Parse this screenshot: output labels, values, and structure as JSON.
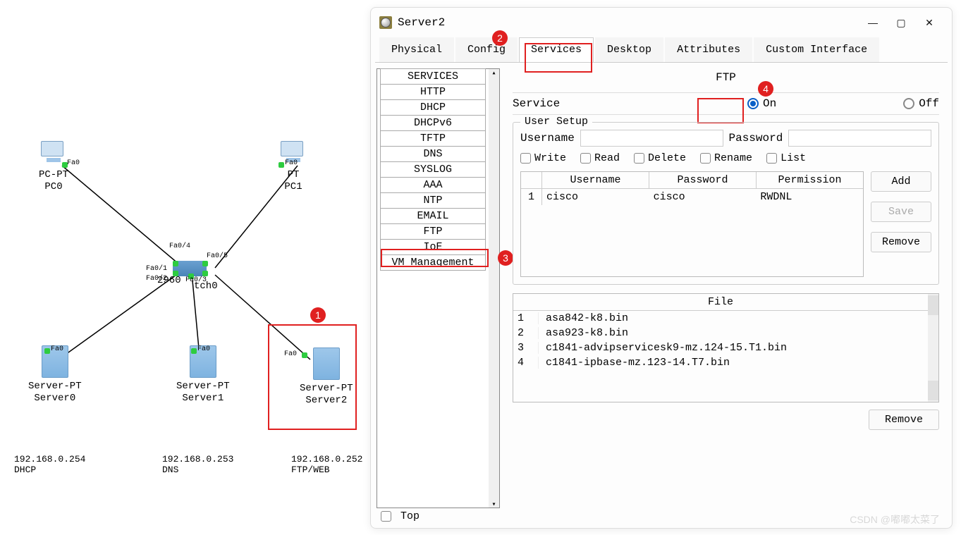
{
  "topology": {
    "pc0": {
      "label1": "PC-PT",
      "label2": "PC0",
      "port": "Fa0"
    },
    "pc1": {
      "label1": "PT",
      "label2": "PC1",
      "port": "Fa0"
    },
    "switch": {
      "label": "tch0",
      "hub": "2960",
      "ports": {
        "p1": "Fa0/1",
        "p2": "Fa0/2",
        "p3": "Fa0/3",
        "p4": "Fa0/4",
        "p5": "Fa0/5"
      }
    },
    "server0": {
      "label1": "Server-PT",
      "label2": "Server0",
      "port": "Fa0",
      "ip": "192.168.0.254",
      "svc": "DHCP"
    },
    "server1": {
      "label1": "Server-PT",
      "label2": "Server1",
      "port": "Fa0",
      "ip": "192.168.0.253",
      "svc": "DNS"
    },
    "server2": {
      "label1": "Server-PT",
      "label2": "Server2",
      "port": "Fa0",
      "ip": "192.168.0.252",
      "svc": "FTP/WEB"
    }
  },
  "badges": {
    "b1": "1",
    "b2": "2",
    "b3": "3",
    "b4": "4"
  },
  "dialog": {
    "title": "Server2",
    "tabs": {
      "physical": "Physical",
      "config": "Config",
      "services": "Services",
      "desktop": "Desktop",
      "attributes": "Attributes",
      "custom": "Custom Interface"
    },
    "services": [
      "SERVICES",
      "HTTP",
      "DHCP",
      "DHCPv6",
      "TFTP",
      "DNS",
      "SYSLOG",
      "AAA",
      "NTP",
      "EMAIL",
      "FTP",
      "IoE",
      "VM Management"
    ],
    "ftp": {
      "title": "FTP",
      "serviceLabel": "Service",
      "onLabel": "On",
      "offLabel": "Off",
      "userSetup": "User Setup",
      "usernameLabel": "Username",
      "passwordLabel": "Password",
      "perms": {
        "write": "Write",
        "read": "Read",
        "delete": "Delete",
        "rename": "Rename",
        "list": "List"
      },
      "tableHeaders": {
        "idx": "",
        "user": "Username",
        "pass": "Password",
        "perm": "Permission"
      },
      "users": [
        {
          "idx": "1",
          "name": "cisco",
          "pass": "cisco",
          "perm": "RWDNL"
        }
      ],
      "buttons": {
        "add": "Add",
        "save": "Save",
        "remove": "Remove"
      },
      "fileHeader": "File",
      "files": [
        {
          "idx": "1",
          "name": "asa842-k8.bin"
        },
        {
          "idx": "2",
          "name": "asa923-k8.bin"
        },
        {
          "idx": "3",
          "name": "c1841-advipservicesk9-mz.124-15.T1.bin"
        },
        {
          "idx": "4",
          "name": "c1841-ipbase-mz.123-14.T7.bin"
        }
      ],
      "removeFile": "Remove"
    },
    "footer": {
      "top": "Top"
    }
  },
  "watermark": "CSDN @嘟嘟太菜了"
}
